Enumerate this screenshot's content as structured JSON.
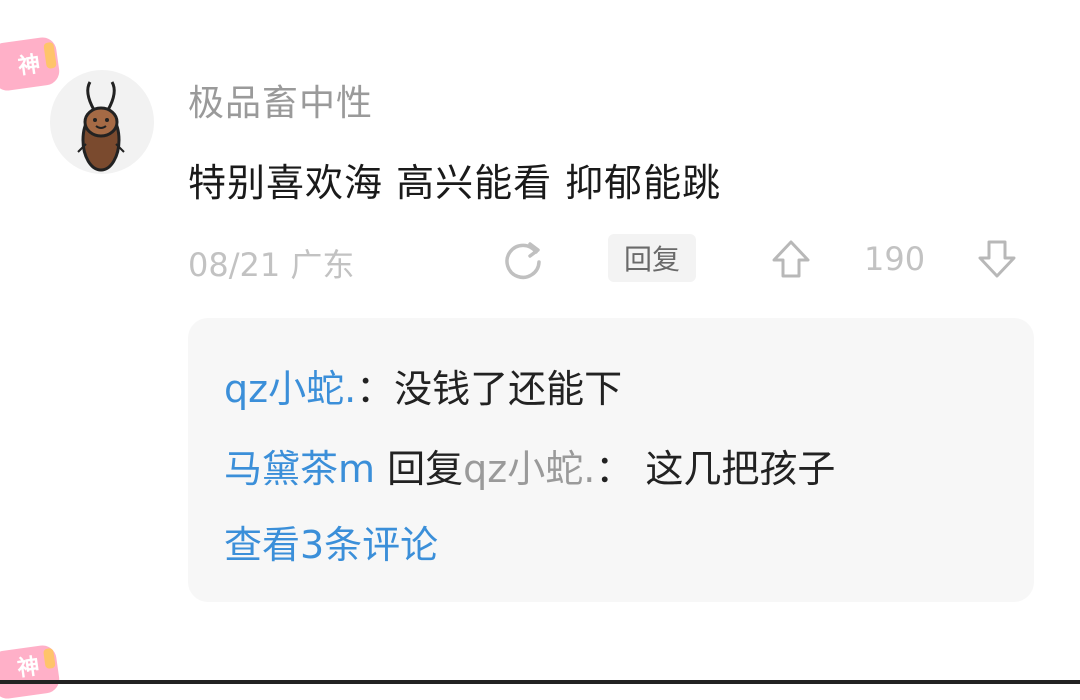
{
  "comment": {
    "badge_label": "神",
    "username": "极品畜中性",
    "text": "特别喜欢海 高兴能看 抑郁能跳",
    "meta": {
      "date_location": "08/21 广东",
      "reply_label": "回复",
      "vote_count": "190"
    }
  },
  "replies": {
    "line1": {
      "author": "qz小蛇.",
      "separator": "：",
      "text": "没钱了还能下"
    },
    "line2": {
      "author": "马黛茶m",
      "reply_word": "回复",
      "target": "qz小蛇.",
      "separator": "：",
      "text": "这几把孩子"
    },
    "view_more": "查看3条评论"
  },
  "next_comment": {
    "badge_label": "神"
  },
  "colors": {
    "badge_pink": "#ffb0c8",
    "link_blue": "#3b8fd9",
    "reply_box_bg": "#f7f7f7"
  },
  "icons": {
    "share": "refresh-circle-icon",
    "upvote": "arrow-up-icon",
    "downvote": "arrow-down-icon"
  }
}
